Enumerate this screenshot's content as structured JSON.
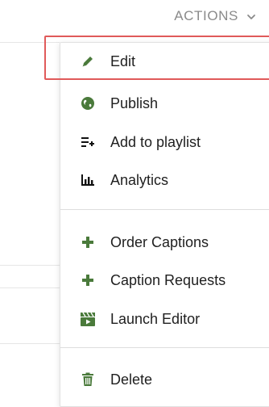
{
  "header": {
    "actions_label": "ACTIONS",
    "chevron_icon": "chevron-down-icon"
  },
  "menu": {
    "items": [
      {
        "label": "Edit",
        "icon": "pencil-icon"
      },
      {
        "label": "Publish",
        "icon": "globe-icon"
      },
      {
        "label": "Add to playlist",
        "icon": "add-to-playlist-icon"
      },
      {
        "label": "Analytics",
        "icon": "bar-chart-icon"
      },
      {
        "label": "Order Captions",
        "icon": "plus-icon"
      },
      {
        "label": "Caption Requests",
        "icon": "plus-icon"
      },
      {
        "label": "Launch Editor",
        "icon": "video-editor-icon"
      },
      {
        "label": "Delete",
        "icon": "trash-icon"
      }
    ]
  },
  "colors": {
    "icon_green": "#4a7a3b",
    "highlight_red": "#e05a5a",
    "actions_gray": "#8a8a8a"
  }
}
